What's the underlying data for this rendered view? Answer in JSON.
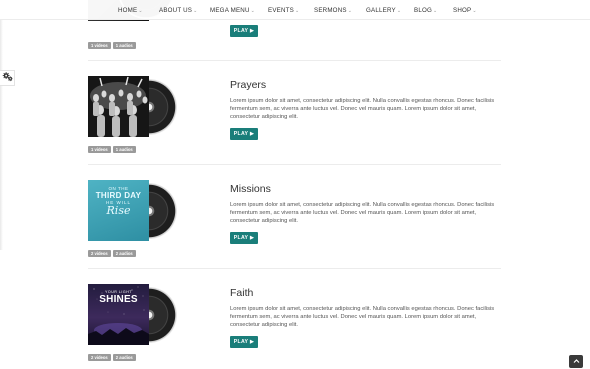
{
  "nav": {
    "items": [
      {
        "label": "HOME"
      },
      {
        "label": "ABOUT US"
      },
      {
        "label": "MEGA MENU"
      },
      {
        "label": "EVENTS"
      },
      {
        "label": "SERMONS"
      },
      {
        "label": "GALLERY"
      },
      {
        "label": "BLOG"
      },
      {
        "label": "SHOP"
      }
    ]
  },
  "sermons": [
    {
      "title": "",
      "description": "",
      "play_label": "PLAY ▶",
      "badges": [
        "1 videos",
        "1 audios"
      ],
      "cover_theme": "dark-partial"
    },
    {
      "title": "Prayers",
      "description": "Lorem ipsum dolor sit amet, consectetur adipiscing elit. Nulla convallis egestas rhoncus. Donec facilisis fermentum sem, ac viverra ante luctus vel. Donec vel mauris quam. Lorem ipsum dolor sit amet, consectetur adipiscing elit.",
      "play_label": "PLAY ▶",
      "badges": [
        "1 videos",
        "1 audios"
      ],
      "cover_theme": "crowd-bw"
    },
    {
      "title": "Missions",
      "description": "Lorem ipsum dolor sit amet, consectetur adipiscing elit. Nulla convallis egestas rhoncus. Donec facilisis fermentum sem, ac viverra ante luctus vel. Donec vel mauris quam. Lorem ipsum dolor sit amet, consectetur adipiscing elit.",
      "play_label": "PLAY ▶",
      "badges": [
        "2 videos",
        "2 audios"
      ],
      "cover_theme": "teal",
      "cover_text": {
        "line1": "ON THE",
        "line2": "THIRD DAY",
        "line3": "HE WILL",
        "line4": "Rise"
      }
    },
    {
      "title": "Faith",
      "description": "Lorem ipsum dolor sit amet, consectetur adipiscing elit. Nulla convallis egestas rhoncus. Donec facilisis fermentum sem, ac viverra ante luctus vel. Donec vel mauris quam. Lorem ipsum dolor sit amet, consectetur adipiscing elit.",
      "play_label": "PLAY ▶",
      "badges": [
        "2 videos",
        "2 audios"
      ],
      "cover_theme": "night",
      "cover_text": {
        "small": "YOUR LIGHT",
        "big": "SHINES"
      }
    }
  ],
  "colors": {
    "accent": "#1a7e7a",
    "badge": "#9a9a9a",
    "title": "#333333",
    "body": "#555555"
  },
  "icons": {
    "settings": "gears-icon",
    "scroll_top": "chevron-up-icon",
    "nav_dropdown": "chevron-down-icon"
  }
}
